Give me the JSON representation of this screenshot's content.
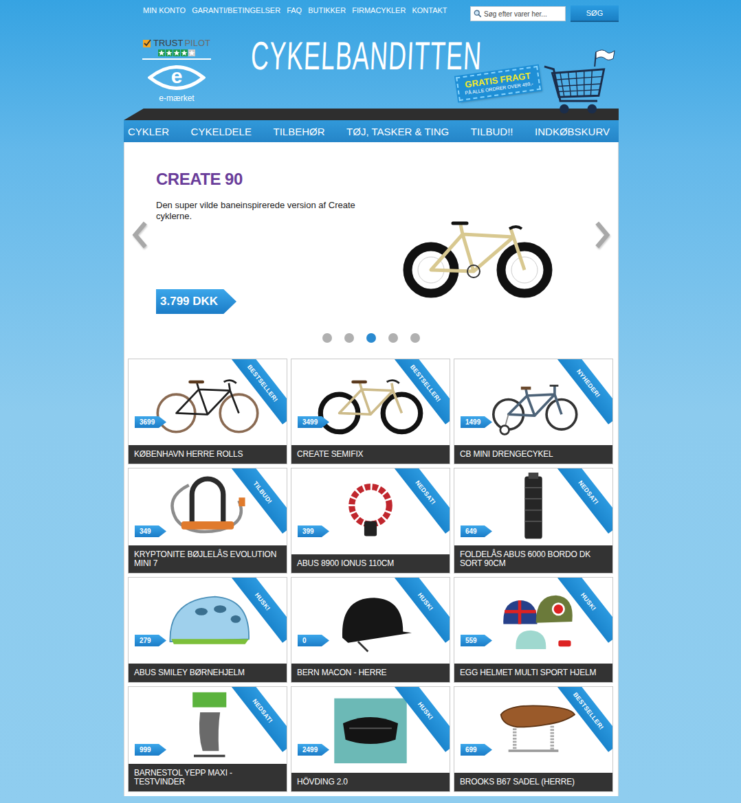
{
  "topbar": {
    "links": [
      "MIN KONTO",
      "GARANTI/BETINGELSER",
      "FAQ",
      "BUTIKKER",
      "FIRMACYKLER",
      "KONTAKT"
    ],
    "search": {
      "placeholder": "Søg efter varer her...",
      "button": "SØG"
    }
  },
  "header": {
    "trustpilot": {
      "words": [
        "TRUST",
        "PILOT"
      ],
      "stars": 4
    },
    "emark": {
      "mark": "e",
      "label": "e-mærket"
    },
    "logo": "CYKELBANDITTEN",
    "badge": {
      "title": "GRATIS FRAGT",
      "subtitle": "PÅ ALLE ORDRER OVER 499,-"
    }
  },
  "nav": [
    "CYKLER",
    "CYKELDELE",
    "TILBEHØR",
    "TØJ, TASKER & TING",
    "TILBUD!!",
    "INDKØBSKURV"
  ],
  "slider": {
    "title": "CREATE 90",
    "description": "Den super vilde baneinspirerede version af Create cyklerne.",
    "price": "3.799 DKK",
    "dots": [
      {
        "selected": false
      },
      {
        "selected": false
      },
      {
        "selected": true
      },
      {
        "selected": false
      },
      {
        "selected": false
      }
    ]
  },
  "products": [
    {
      "name": "KØBENHAVN HERRE ROLLS",
      "price": "3699",
      "ribbon": "BESTSELLER!",
      "image": "bike-classic"
    },
    {
      "name": "CREATE SEMIFIX",
      "price": "3499",
      "ribbon": "BESTSELLER!",
      "image": "bike-fixie"
    },
    {
      "name": "CB MINI DRENGECYKEL",
      "price": "1499",
      "ribbon": "NYHEDER!",
      "image": "bike-kids"
    },
    {
      "name": "KRYPTONITE BØJLELÅS EVOLUTION MINI 7",
      "price": "349",
      "ribbon": "TILBUD!",
      "image": "u-lock"
    },
    {
      "name": "ABUS 8900 IONUS 110CM",
      "price": "399",
      "ribbon": "NEDSAT!",
      "image": "chain-lock"
    },
    {
      "name": "FOLDELÅS ABUS 6000 BORDO DK SORT 90CM",
      "price": "649",
      "ribbon": "NEDSAT!",
      "image": "fold-lock"
    },
    {
      "name": "ABUS SMILEY BØRNEHJELM",
      "price": "279",
      "ribbon": "HUSK!",
      "image": "kids-helmet"
    },
    {
      "name": "BERN MACON - HERRE",
      "price": "0",
      "ribbon": "HUSK!",
      "image": "helmet"
    },
    {
      "name": "EGG HELMET MULTI SPORT HJELM",
      "price": "559",
      "ribbon": "HUSK!",
      "image": "helmet-set"
    },
    {
      "name": "BARNESTOL YEPP MAXI - TESTVINDER",
      "price": "999",
      "ribbon": "NEDSAT!",
      "image": "child-seat"
    },
    {
      "name": "HÖVDING 2.0",
      "price": "2499",
      "ribbon": "HUSK!",
      "image": "airbag"
    },
    {
      "name": "BROOKS B67 SADEL (HERRE)",
      "price": "699",
      "ribbon": "BESTSELLER!",
      "image": "saddle"
    }
  ]
}
